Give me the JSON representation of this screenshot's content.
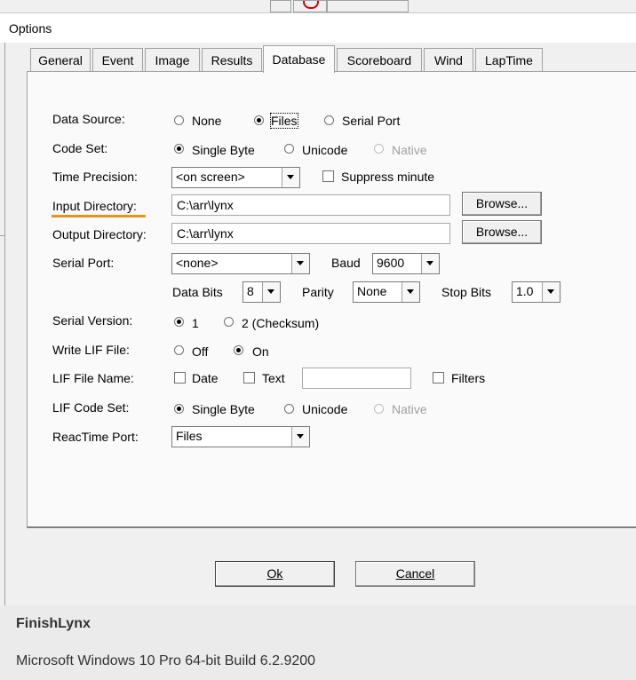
{
  "window": {
    "title": "Options"
  },
  "tabs": [
    "General",
    "Event",
    "Image",
    "Results",
    "Database",
    "Scoreboard",
    "Wind",
    "LapTime"
  ],
  "active_tab": "Database",
  "accent_color": "#e8941a",
  "form": {
    "data_source": {
      "label": "Data Source:",
      "options": [
        "None",
        "Files",
        "Serial Port"
      ],
      "selected": "Files"
    },
    "code_set": {
      "label": "Code Set:",
      "options": [
        "Single Byte",
        "Unicode",
        "Native"
      ],
      "selected": "Single Byte",
      "disabled": [
        "Native"
      ]
    },
    "time_precision": {
      "label": "Time Precision:",
      "value": "<on screen>",
      "suppress_label": "Suppress minute",
      "suppress_checked": false
    },
    "input_directory": {
      "label": "Input Directory:",
      "value": "C:\\arr\\lynx",
      "browse": "Browse..."
    },
    "output_directory": {
      "label": "Output Directory:",
      "value": "C:\\arr\\lynx",
      "browse": "Browse..."
    },
    "serial_port": {
      "label": "Serial Port:",
      "value": "<none>",
      "baud_label": "Baud",
      "baud": "9600",
      "data_bits_label": "Data Bits",
      "data_bits": "8",
      "parity_label": "Parity",
      "parity": "None",
      "stop_bits_label": "Stop Bits",
      "stop_bits": "1.0"
    },
    "serial_version": {
      "label": "Serial Version:",
      "options": [
        "1",
        "2 (Checksum)"
      ],
      "selected": "1"
    },
    "write_lif": {
      "label": "Write LIF File:",
      "options": [
        "Off",
        "On"
      ],
      "selected": "On"
    },
    "lif_file_name": {
      "label": "LIF File Name:",
      "date_label": "Date",
      "text_label": "Text",
      "text_value": "",
      "filters_label": "Filters"
    },
    "lif_code_set": {
      "label": "LIF Code Set:",
      "options": [
        "Single Byte",
        "Unicode",
        "Native"
      ],
      "selected": "Single Byte",
      "disabled": [
        "Native"
      ]
    },
    "reactime_port": {
      "label": "ReacTime Port:",
      "value": "Files"
    }
  },
  "buttons": {
    "ok": "Ok",
    "cancel": "Cancel"
  },
  "footer": {
    "app": "FinishLynx",
    "os": "Microsoft Windows 10 Pro 64-bit Build 6.2.9200"
  }
}
